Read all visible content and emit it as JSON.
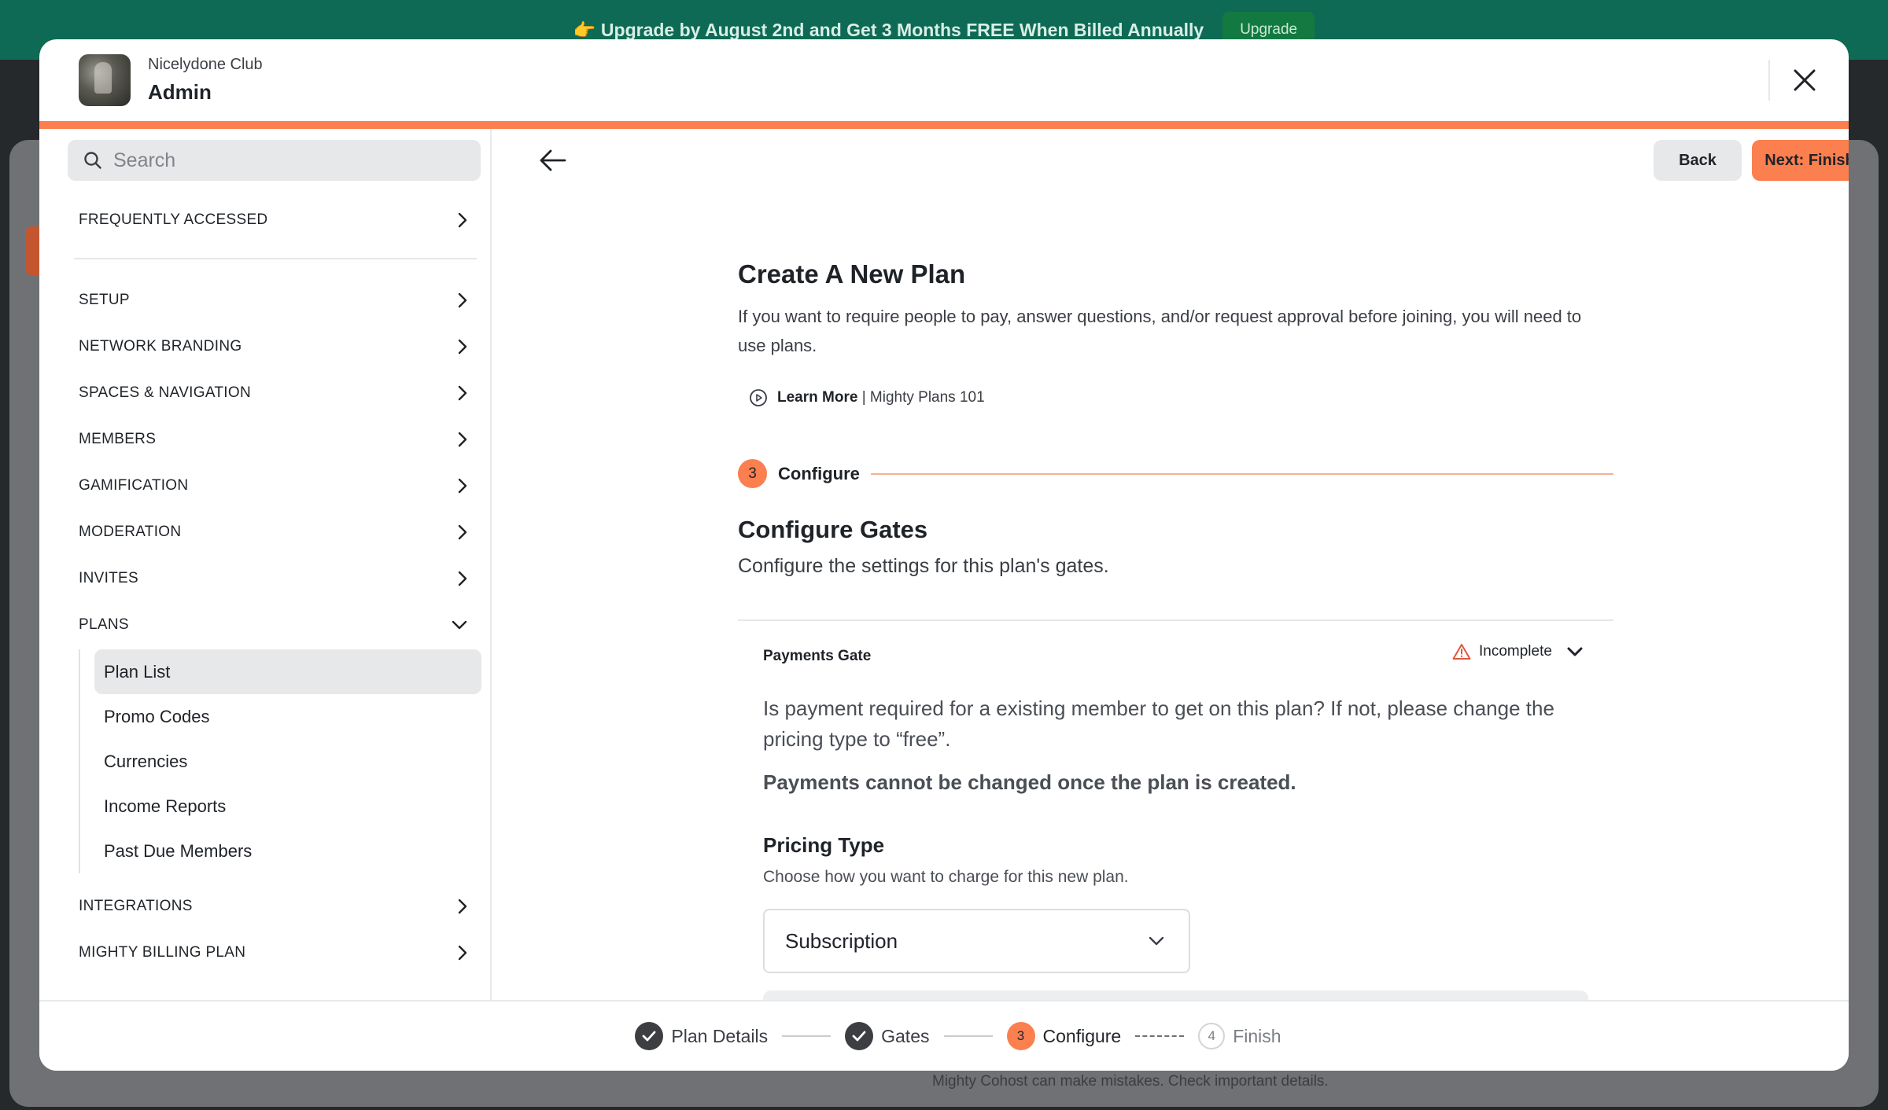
{
  "promo": {
    "text": "👉 Upgrade by August 2nd and Get 3 Months FREE When Billed Annually",
    "button": "Upgrade"
  },
  "background": {
    "footnote": "Mighty Cohost can make mistakes. Check important details."
  },
  "header": {
    "club_name": "Nicelydone Club",
    "title": "Admin"
  },
  "sidebar": {
    "search_placeholder": "Search",
    "frequently_accessed": "FREQUENTLY ACCESSED",
    "items": [
      "SETUP",
      "NETWORK BRANDING",
      "SPACES & NAVIGATION",
      "MEMBERS",
      "GAMIFICATION",
      "MODERATION",
      "INVITES",
      "PLANS"
    ],
    "plans_sub": [
      "Plan List",
      "Promo Codes",
      "Currencies",
      "Income Reports",
      "Past Due Members"
    ],
    "bottom_items": [
      "INTEGRATIONS",
      "MIGHTY BILLING PLAN"
    ]
  },
  "toolbar": {
    "back_label": "Back",
    "next_label": "Next: Finish"
  },
  "content": {
    "title": "Create A New Plan",
    "description": "If you want to require people to pay, answer questions, and/or request approval before joining, you will need to use plans.",
    "learn_more_bold": "Learn More",
    "learn_more_rest": "| Mighty Plans 101",
    "step_number": "3",
    "step_label": "Configure",
    "section_title": "Configure Gates",
    "section_subtitle": "Configure the settings for this plan's gates.",
    "gate": {
      "title": "Payments Gate",
      "status": "Incomplete",
      "text": "Is payment required for a existing member to get on this plan? If not, please change the pricing type to “free”.",
      "warning": "Payments cannot be changed once the plan is created.",
      "pricing_title": "Pricing Type",
      "pricing_subtitle": "Choose how you want to charge for this new plan.",
      "pricing_value": "Subscription"
    }
  },
  "wizard": {
    "steps": [
      {
        "label": "Plan Details",
        "state": "done"
      },
      {
        "label": "Gates",
        "state": "done"
      },
      {
        "label": "Configure",
        "state": "current",
        "number": "3"
      },
      {
        "label": "Finish",
        "state": "todo",
        "number": "4"
      }
    ]
  },
  "colors": {
    "accent": "#fb7f4f",
    "promo_bg": "#0e6a55"
  }
}
